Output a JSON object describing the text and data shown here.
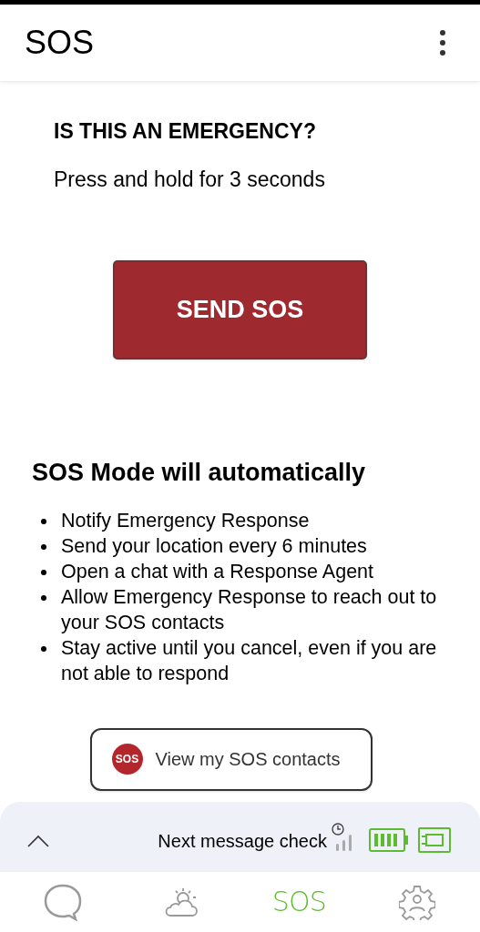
{
  "app_bar": {
    "title": "SOS"
  },
  "prompt": {
    "heading": "IS THIS AN EMERGENCY?",
    "instruction": "Press and hold for 3 seconds"
  },
  "send_button": {
    "label": "SEND SOS"
  },
  "info": {
    "heading": "SOS Mode will automatically",
    "items": [
      "Notify Emergency Response",
      "Send your location every 6 minutes",
      "Open a chat with a Response Agent",
      "Allow Emergency Response to reach out to your SOS contacts",
      "Stay active until you cancel, even if you are not able to respond"
    ]
  },
  "contacts_button": {
    "badge": "SOS",
    "label": "View my SOS contacts"
  },
  "status_sheet": {
    "expanded": false,
    "text": "Next message check"
  },
  "bottom_nav": [
    {
      "kind": "chat",
      "selected": false
    },
    {
      "kind": "weather",
      "selected": false
    },
    {
      "kind": "text",
      "label": "SOS",
      "selected": true
    },
    {
      "kind": "settings",
      "selected": false
    }
  ]
}
